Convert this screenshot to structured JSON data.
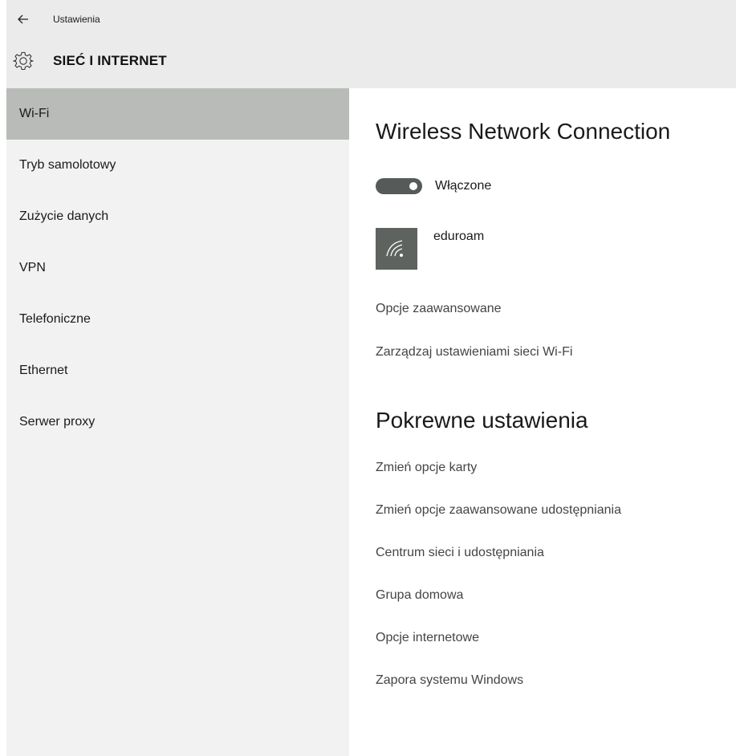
{
  "app": {
    "title": "Ustawienia",
    "section_title": "SIEĆ I INTERNET",
    "back_icon": "back-arrow-icon",
    "section_icon": "gear-icon"
  },
  "sidebar": {
    "items": [
      {
        "label": "Wi-Fi",
        "active": true
      },
      {
        "label": "Tryb samolotowy",
        "active": false
      },
      {
        "label": "Zużycie danych",
        "active": false
      },
      {
        "label": "VPN",
        "active": false
      },
      {
        "label": "Telefoniczne",
        "active": false
      },
      {
        "label": "Ethernet",
        "active": false
      },
      {
        "label": "Serwer proxy",
        "active": false
      }
    ]
  },
  "main": {
    "connection_title": "Wireless Network Connection",
    "toggle": {
      "label": "Włączone",
      "state": "on"
    },
    "network": {
      "name": "eduroam",
      "icon": "wifi-signal-icon"
    },
    "links": [
      "Opcje zaawansowane",
      "Zarządzaj ustawieniami sieci Wi-Fi"
    ],
    "related_title": "Pokrewne ustawienia",
    "related_links": [
      "Zmień opcje karty",
      "Zmień opcje zaawansowane udostępniania",
      "Centrum sieci i udostępniania",
      "Grupa domowa",
      "Opcje internetowe",
      "Zapora systemu Windows"
    ]
  },
  "colors": {
    "header_bg": "#ebebeb",
    "sidebar_bg": "#f2f2f2",
    "active_item_bg": "#b8bbb8",
    "toggle_on": "#565b59",
    "network_tile": "#5e635f"
  }
}
